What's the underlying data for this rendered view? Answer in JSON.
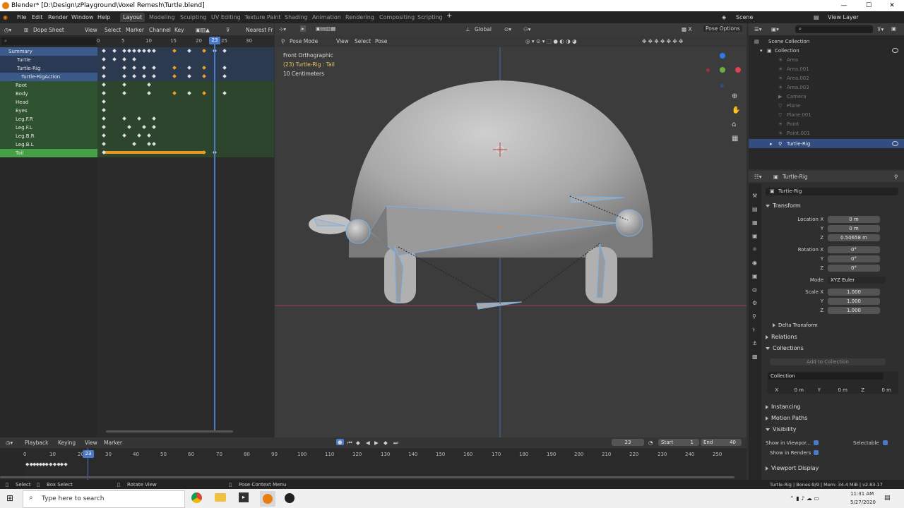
{
  "window": {
    "title": "Blender* [D:\\Design\\zPlayground\\Voxel Remesh\\Turtle.blend]",
    "min": "—",
    "max": "☐",
    "close": "✕"
  },
  "menu": [
    "File",
    "Edit",
    "Render",
    "Window",
    "Help"
  ],
  "workspaces": [
    "Layout",
    "Modeling",
    "Sculpting",
    "UV Editing",
    "Texture Paint",
    "Shading",
    "Animation",
    "Rendering",
    "Compositing",
    "Scripting"
  ],
  "scene": {
    "name": "Scene",
    "view_layer": "View Layer"
  },
  "dope": {
    "editor": "Dope Sheet",
    "menus": [
      "View",
      "Select",
      "Marker",
      "Channel",
      "Key"
    ],
    "snap": "Nearest Fr",
    "ruler": [
      "0",
      "5",
      "10",
      "15",
      "20",
      "25",
      "30"
    ],
    "current_frame": "23",
    "channels": [
      "Summary",
      "Turtle",
      "Turtle-Rig",
      "Turtle-RigAction",
      "Root",
      "Body",
      "Head",
      "Eyes",
      "Leg.F.R",
      "Leg.F.L",
      "Leg.B.R",
      "Leg.B.L",
      "Tail"
    ]
  },
  "viewport": {
    "mode": "Pose Mode",
    "menus": [
      "View",
      "Select",
      "Pose"
    ],
    "orientation": "Global",
    "pose_options": "Pose Options",
    "info1": "Front Orthographic",
    "info2": "(23) Turtle-Rig : Tail",
    "info3": "10 Centimeters"
  },
  "outliner": {
    "root": "Scene Collection",
    "collection": "Collection",
    "items": [
      "Area",
      "Area.001",
      "Area.002",
      "Area.003",
      "Camera",
      "Plane",
      "Plane.001",
      "Point",
      "Point.001",
      "Turtle-Rig"
    ]
  },
  "properties": {
    "object_name": "Turtle-Rig",
    "object_field": "Turtle-Rig",
    "transform": "Transform",
    "location_x_label": "Location X",
    "y": "Y",
    "z": "Z",
    "loc": [
      "0 m",
      "0 m",
      "0.50658 m"
    ],
    "rotation_x_label": "Rotation X",
    "rot": [
      "0°",
      "0°",
      "0°"
    ],
    "mode_label": "Mode",
    "mode": "XYZ Euler",
    "scale_x_label": "Scale X",
    "scale": [
      "1.000",
      "1.000",
      "1.000"
    ],
    "delta": "Delta Transform",
    "relations": "Relations",
    "collections": "Collections",
    "add_collection": "Add to Collection",
    "coll_name": "Collection",
    "coll_x": "X",
    "coll_x_val": "0 m",
    "coll_y": "Y",
    "coll_y_val": "0 m",
    "coll_z": "Z",
    "coll_z_val": "0 m",
    "instancing": "Instancing",
    "motion_paths": "Motion Paths",
    "visibility": "Visibility",
    "show_viewport": "Show in Viewpor...",
    "selectable": "Selectable",
    "show_renders": "Show in Renders",
    "viewport_display": "Viewport Display"
  },
  "timeline": {
    "menus": [
      "Playback",
      "Keying",
      "View",
      "Marker"
    ],
    "frame": "23",
    "start_label": "Start",
    "start": "1",
    "end_label": "End",
    "end": "40",
    "ruler": [
      "0",
      "10",
      "20",
      "30",
      "40",
      "50",
      "60",
      "70",
      "80",
      "90",
      "100",
      "110",
      "120",
      "130",
      "140",
      "150",
      "160",
      "170",
      "180",
      "190",
      "200",
      "210",
      "220",
      "230",
      "240",
      "250"
    ]
  },
  "status": {
    "select": "Select",
    "box_select": "Box Select",
    "rotate_view": "Rotate View",
    "context_menu": "Pose Context Menu",
    "info": "Turtle-Rig | Bones:9/9 | Mem: 34.4 MiB | v2.83.17"
  },
  "taskbar": {
    "search": "Type here to search",
    "time": "11:31 AM",
    "date": "5/27/2020"
  }
}
